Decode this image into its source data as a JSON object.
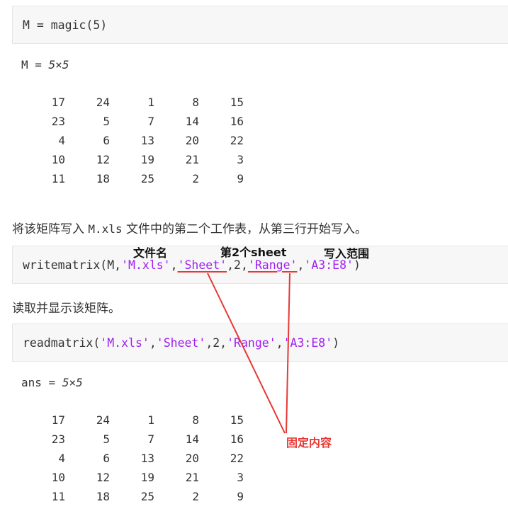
{
  "block1": {
    "code": "M = magic(5)"
  },
  "output1": {
    "var": "M",
    "eq": " = ",
    "dims": "5×5",
    "rows": [
      [
        "17",
        "24",
        "1",
        "8",
        "15"
      ],
      [
        "23",
        "5",
        "7",
        "14",
        "16"
      ],
      [
        "4",
        "6",
        "13",
        "20",
        "22"
      ],
      [
        "10",
        "12",
        "19",
        "21",
        "3"
      ],
      [
        "11",
        "18",
        "25",
        "2",
        "9"
      ]
    ]
  },
  "para1": {
    "pre": "将该矩阵写入 ",
    "code": "M.xls",
    "post": " 文件中的第二个工作表，从第三行开始写入。"
  },
  "block2": {
    "fn": "writematrix(M,",
    "arg_file": "'M.xls'",
    "comma1": ",",
    "arg_sheet": "'Sheet'",
    "mid": ",2,",
    "arg_range": "'Range'",
    "comma2": ",",
    "arg_addr": "'A3:E8'",
    "close": ")"
  },
  "para2": {
    "text": "读取并显示该矩阵。"
  },
  "block3": {
    "fn": "readmatrix(",
    "arg_file": "'M.xls'",
    "comma1": ",",
    "arg_sheet": "'Sheet'",
    "mid": ",2,",
    "arg_range": "'Range'",
    "comma2": ",",
    "arg_addr": "'A3:E8'",
    "close": ")"
  },
  "output2": {
    "var": "ans",
    "eq": " = ",
    "dims": "5×5",
    "rows": [
      [
        "17",
        "24",
        "1",
        "8",
        "15"
      ],
      [
        "23",
        "5",
        "7",
        "14",
        "16"
      ],
      [
        "4",
        "6",
        "13",
        "20",
        "22"
      ],
      [
        "10",
        "12",
        "19",
        "21",
        "3"
      ],
      [
        "11",
        "18",
        "25",
        "2",
        "9"
      ]
    ]
  },
  "annotations": {
    "file_name": "文件名",
    "sheet2": "第2个sheet",
    "write_range": "写入范围",
    "fixed_content": "固定内容",
    "arrow_color": "#e53935"
  },
  "colors": {
    "string": "#a020f0",
    "code_bg": "#f7f7f7",
    "annotation_red": "#e53935"
  }
}
